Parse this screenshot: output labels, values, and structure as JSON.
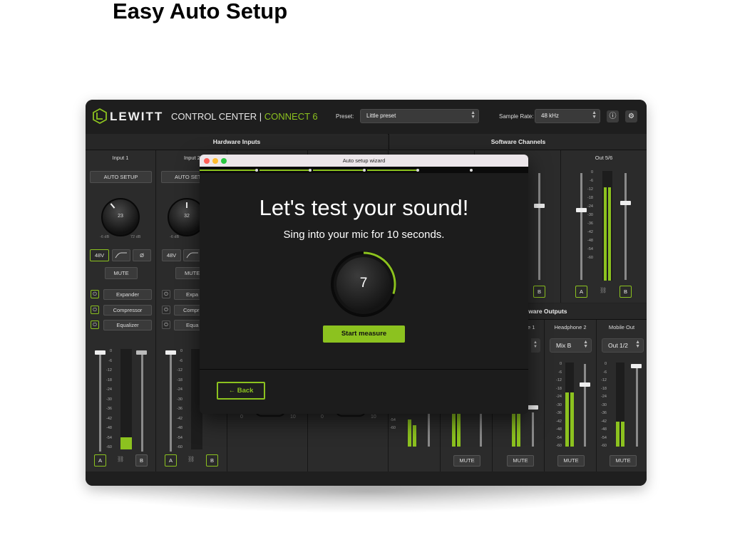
{
  "page": {
    "title": "Easy Auto Setup"
  },
  "app": {
    "brand": "LEWITT",
    "product": "CONTROL CENTER",
    "separator": " | ",
    "model": "CONNECT 6",
    "preset_label": "Preset:",
    "preset_value": "Little preset",
    "sample_rate_label": "Sample Rate:",
    "sample_rate_value": "48 kHz",
    "info_icon": "info-icon",
    "settings_icon": "gear-icon",
    "accent_color": "#8cc21f"
  },
  "sections": {
    "hardware_inputs": "Hardware Inputs",
    "software_channels": "Software Channels",
    "hardware_outputs": "Hardware Outputs",
    "hardware_outputs_visible": "dware Outputs"
  },
  "inputs": [
    {
      "label": "Input 1",
      "auto_setup": "AUTO SETUP",
      "gain": "23",
      "min": "-6 dB",
      "max": "72 dB",
      "phantom": "48V",
      "hpf_icon": "high-pass-icon",
      "phase": "Ø",
      "mute": "MUTE",
      "expander": "Expander",
      "compressor": "Compressor",
      "equalizer": "Equalizer",
      "a": "A",
      "b": "B",
      "meter_level": 0.12,
      "fader_level": 1.0
    },
    {
      "label": "Input 2",
      "label_visible": "Input 2",
      "auto_setup": "AUTO SETUP",
      "auto_setup_visible": "AUTO SET",
      "gain": "32",
      "min": "-6 dB",
      "phantom": "48V",
      "mute": "MUTE",
      "mute_visible": "MUTE",
      "expander": "Expander",
      "expander_visible": "Expa",
      "compressor": "Compressor",
      "compressor_visible": "Compr",
      "equalizer": "Equalizer",
      "equalizer_visible": "Equa",
      "a": "A",
      "b": "B",
      "fader_level": 1.0
    }
  ],
  "scale_marks": [
    "0",
    "-6",
    "-12",
    "-18",
    "-24",
    "-30",
    "-36",
    "-42",
    "-48",
    "-54",
    "-60"
  ],
  "mid_knob_range": {
    "min": "0",
    "max": "10"
  },
  "software": {
    "out56": {
      "label": "Out 5/6",
      "a": "A",
      "b": "B",
      "meter_level": 0.85
    },
    "partial_b": "B"
  },
  "outputs": [
    {
      "label": "Headphone 1",
      "label_visible": "e 1",
      "mute": "MUTE"
    },
    {
      "label": "Headphone 2",
      "select": "Mix B",
      "mute": "MUTE",
      "meter_level": 0.64
    },
    {
      "label": "Mobile Out",
      "select": "Out 1/2",
      "mute": "MUTE",
      "meter_level": 0.3
    },
    {
      "label": "",
      "mute": "MUTE"
    },
    {
      "label": "",
      "mute": "MUTE"
    }
  ],
  "scale_marks_visible_partial": [
    "-48",
    "-54",
    "-60"
  ],
  "wizard": {
    "window_title": "Auto setup wizard",
    "headline": "Let's test your sound!",
    "instruction": "Sing into your mic for 10 seconds.",
    "countdown": "7",
    "countdown_progress": 0.3,
    "start_button": "Start measure",
    "back_button": "← Back",
    "steps_total": 5,
    "steps_done": 4
  }
}
